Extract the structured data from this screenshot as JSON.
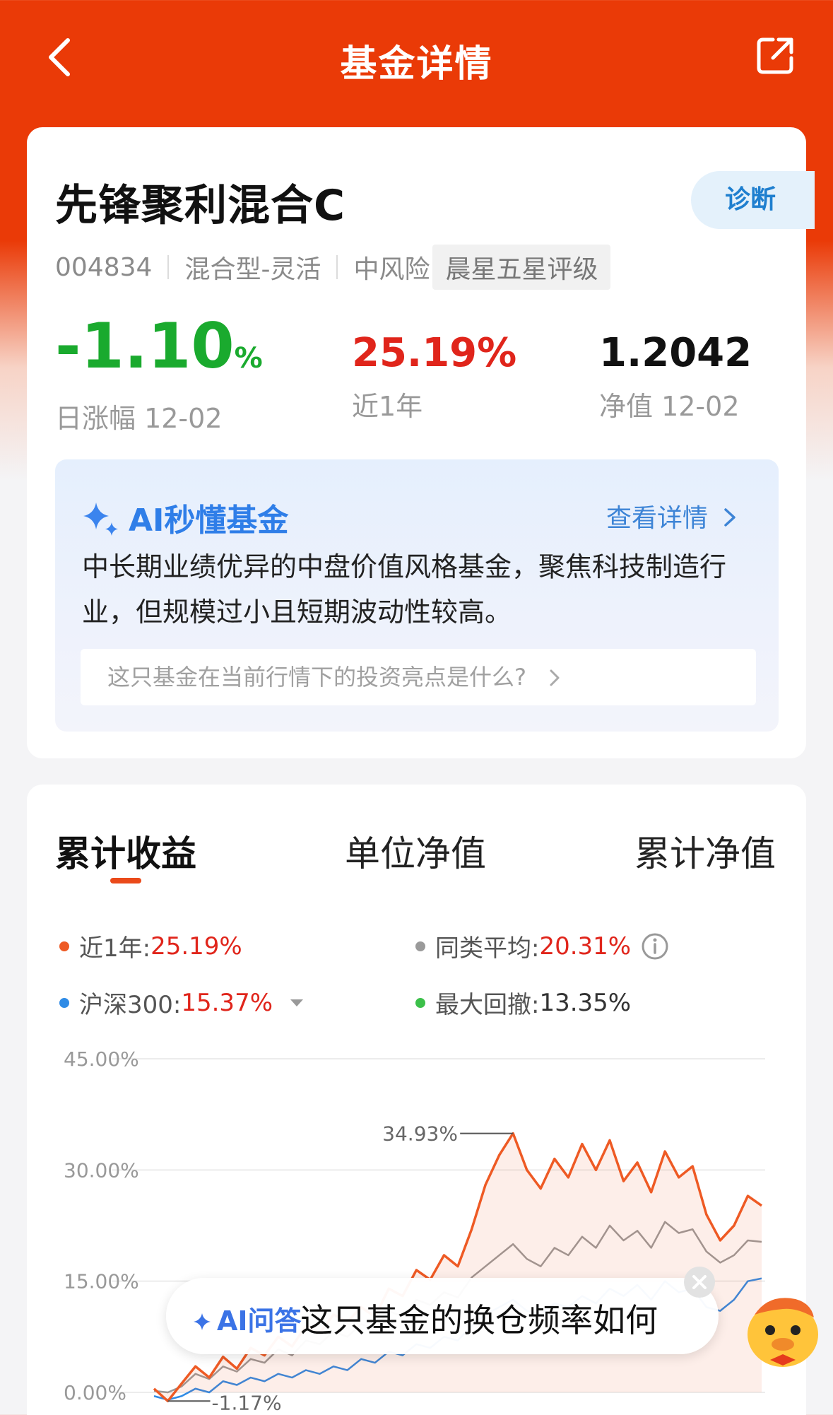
{
  "header": {
    "title": "基金详情"
  },
  "fund": {
    "name": "先锋聚利混合C",
    "diagnose_label": "诊断",
    "code": "004834",
    "type": "混合型-灵活",
    "risk": "中风险",
    "rating": "晨星五星评级",
    "daily_change_value": "-1.10",
    "daily_change_unit": "%",
    "daily_change_label": "日涨幅 12-02",
    "year_return_value": "25.19%",
    "year_return_label": "近1年",
    "nav_value": "1.2042",
    "nav_label": "净值 12-02"
  },
  "ai_summary": {
    "title": "AI秒懂基金",
    "more_label": "查看详情",
    "text": "中长期业绩优异的中盘价值风格基金，聚焦科技制造行业，但规模过小且短期波动性较高。",
    "question": "这只基金在当前行情下的投资亮点是什么?"
  },
  "chart_tabs": [
    "累计收益",
    "单位净值",
    "累计净值"
  ],
  "legend": {
    "fund_label": "近1年:",
    "fund_value": "25.19%",
    "peer_label": "同类平均:",
    "peer_value": "20.31%",
    "index_label": "沪深300:",
    "index_value": "15.37%",
    "drawdown_label": "最大回撤:",
    "drawdown_value": "13.35%"
  },
  "colors": {
    "fund": "#ee5a24",
    "peer": "#9a9a9a",
    "index": "#2f8be6",
    "drawdown": "#3cc04a",
    "brand": "#ea3a07"
  },
  "chart_data": {
    "type": "line",
    "y_ticks": [
      "45.00%",
      "30.00%",
      "15.00%",
      "0.00%"
    ],
    "ylim": [
      0,
      45
    ],
    "annotations": {
      "max": "34.93%",
      "min": "-1.17%"
    },
    "series": [
      {
        "name": "近1年",
        "values": [
          0.5,
          -1.17,
          1.2,
          3.5,
          2.0,
          4.8,
          3.2,
          6.0,
          5.0,
          7.5,
          6.2,
          9.0,
          8.0,
          10.5,
          9.5,
          11.5,
          10.2,
          14.0,
          13.0,
          16.5,
          15.2,
          18.5,
          17.0,
          22.0,
          28.0,
          32.0,
          34.93,
          30.0,
          27.5,
          31.5,
          29.0,
          33.5,
          30.0,
          34.0,
          28.5,
          31.0,
          27.0,
          32.5,
          29.0,
          30.5,
          24.0,
          20.5,
          22.5,
          26.5,
          25.19
        ]
      },
      {
        "name": "同类平均",
        "values": [
          0.2,
          0.0,
          0.8,
          2.5,
          1.8,
          3.5,
          2.8,
          4.5,
          4.0,
          5.8,
          5.0,
          7.0,
          6.5,
          8.2,
          7.5,
          9.2,
          8.5,
          11.0,
          10.2,
          12.5,
          11.8,
          13.5,
          12.8,
          15.5,
          17.0,
          18.5,
          20.0,
          18.0,
          17.0,
          19.5,
          18.5,
          21.0,
          19.5,
          22.5,
          20.5,
          21.8,
          19.5,
          23.0,
          21.5,
          22.0,
          19.0,
          17.5,
          18.5,
          20.5,
          20.31
        ]
      },
      {
        "name": "沪深300",
        "values": [
          -0.5,
          -1.0,
          -0.5,
          0.5,
          0.0,
          1.5,
          1.0,
          2.0,
          1.5,
          2.5,
          2.0,
          3.0,
          2.5,
          3.5,
          3.0,
          4.5,
          4.0,
          5.5,
          5.0,
          6.5,
          6.0,
          7.5,
          7.0,
          9.0,
          10.5,
          11.5,
          12.5,
          11.0,
          10.5,
          12.0,
          11.5,
          13.0,
          12.0,
          14.0,
          13.0,
          14.5,
          12.5,
          15.0,
          13.5,
          14.0,
          11.5,
          11.0,
          12.5,
          15.0,
          15.37
        ]
      }
    ]
  },
  "ai_float": {
    "tag": "AI问答",
    "question": "这只基金的换仓频率如何"
  }
}
